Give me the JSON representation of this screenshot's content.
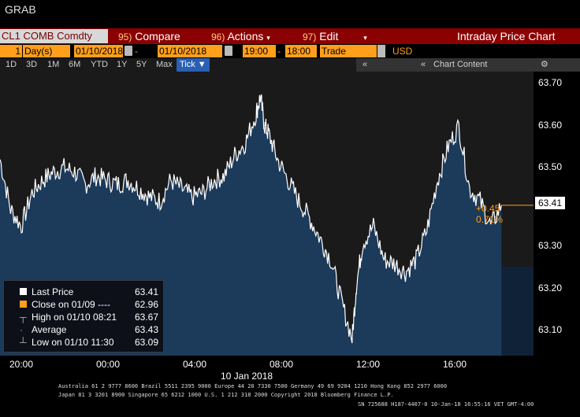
{
  "window": {
    "title": "GRAB"
  },
  "command_bar": {
    "ticker": "CL1 COMB Comdty",
    "compare_num": "95)",
    "compare": "Compare",
    "actions_num": "96)",
    "actions": "Actions",
    "edit_num": "97)",
    "edit": "Edit",
    "panel_title": "Intraday Price Chart"
  },
  "params": {
    "period_count": "1",
    "period_unit": "Day(s)",
    "start_date": "01/10/2018",
    "dash": "-",
    "end_date": "01/10/2018",
    "start_time": "19:00",
    "end_time": "18:00",
    "event": "Trade",
    "currency": "USD"
  },
  "range_buttons": [
    "1D",
    "3D",
    "1M",
    "6M",
    "YTD",
    "1Y",
    "5Y",
    "Max"
  ],
  "tick_button": "Tick ▼",
  "tools": {
    "collapse": "«",
    "chart_content": "Chart Content",
    "settings_icon": "gear-icon"
  },
  "y_axis": [
    "63.70",
    "63.60",
    "63.50",
    "63.40",
    "63.30",
    "63.20",
    "63.10"
  ],
  "x_axis": [
    "20:00",
    "00:00",
    "04:00",
    "08:00",
    "12:00",
    "16:00"
  ],
  "date_label": "10 Jan 2018",
  "last_price_box": "63.41",
  "change": {
    "abs": "+0.45",
    "pct": "0.71%"
  },
  "legend": [
    {
      "label": "Last Price",
      "value": "63.41"
    },
    {
      "label": "Close on 01/09 ----",
      "value": "62.96"
    },
    {
      "label": "High on 01/10 08:21",
      "value": "63.67"
    },
    {
      "label": "Average",
      "value": "63.43"
    },
    {
      "label": "Low on 01/10 11:30",
      "value": "63.09"
    }
  ],
  "footer": {
    "line1": "Australia 61 2 9777 8600 Brazil 5511 2395 9000 Europe 44 20 7330 7500 Germany 49 69 9204 1210 Hong Kong 852 2977 6000",
    "line2": "Japan 81 3 3201 8900       Singapore 65 6212 1000       U.S. 1 212 318 2000          Copyright 2018 Bloomberg Finance L.P.",
    "line3": "SN 725688 H187-4407-0 10-Jan-18 16:55:16 VET  GMT-4:00"
  },
  "colors": {
    "accent": "#ff9f1c",
    "cmdbar": "#8b0000",
    "area": "#1c3a5a",
    "line": "#ffffff"
  },
  "chart_data": {
    "type": "area",
    "x_label_positions_hours": [
      "20:00",
      "00:00",
      "04:00",
      "08:00",
      "12:00",
      "16:00"
    ],
    "series": [
      {
        "name": "Last Price",
        "x": [
          19.0,
          19.5,
          20.0,
          20.5,
          21.0,
          21.5,
          22.0,
          22.5,
          23.0,
          23.5,
          24.0,
          24.5,
          25.0,
          25.5,
          26.0,
          26.5,
          27.0,
          27.5,
          28.0,
          28.5,
          29.0,
          29.5,
          30.0,
          30.5,
          31.0,
          31.2,
          31.4,
          31.6,
          32.0,
          32.5,
          33.0,
          33.5,
          34.0,
          34.5,
          35.0,
          35.5,
          35.7,
          36.0,
          36.5,
          37.0,
          37.5,
          38.0,
          38.5,
          39.0,
          39.5,
          40.0,
          40.5,
          41.0,
          41.5,
          42.0,
          42.5
        ],
        "y": [
          63.52,
          63.4,
          63.36,
          63.44,
          63.47,
          63.49,
          63.5,
          63.49,
          63.46,
          63.48,
          63.47,
          63.46,
          63.47,
          63.45,
          63.43,
          63.42,
          63.47,
          63.45,
          63.43,
          63.44,
          63.47,
          63.48,
          63.53,
          63.56,
          63.63,
          63.67,
          63.6,
          63.58,
          63.52,
          63.47,
          63.42,
          63.38,
          63.33,
          63.28,
          63.18,
          63.09,
          63.22,
          63.32,
          63.36,
          63.28,
          63.27,
          63.25,
          63.28,
          63.35,
          63.47,
          63.55,
          63.6,
          63.45,
          63.42,
          63.36,
          63.41
        ]
      }
    ],
    "prev_close": 62.96,
    "high": 63.67,
    "low": 63.09,
    "average": 63.43,
    "last": 63.41,
    "ylim": [
      63.05,
      63.73
    ],
    "xlim": [
      19.0,
      44.0
    ]
  }
}
